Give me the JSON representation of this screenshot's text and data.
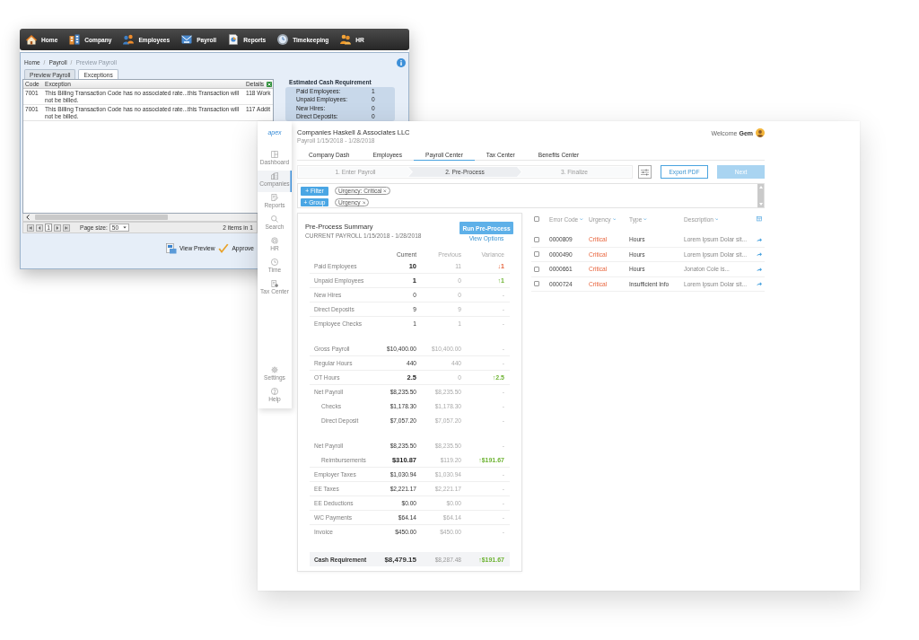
{
  "legacy_window": {
    "nav": [
      {
        "label": "Home"
      },
      {
        "label": "Company"
      },
      {
        "label": "Employees"
      },
      {
        "label": "Payroll"
      },
      {
        "label": "Reports"
      },
      {
        "label": "Timekeeping"
      },
      {
        "label": "HR"
      }
    ],
    "breadcrumb": [
      {
        "label": "Home",
        "current": false
      },
      {
        "label": "Payroll",
        "separator": "/",
        "current": false
      },
      {
        "label": "Preview Payroll",
        "separator": "/",
        "current": true
      }
    ],
    "tabs": [
      {
        "label": "Preview Payroll",
        "selected": false
      },
      {
        "label": "Exceptions",
        "selected": true
      }
    ],
    "table": {
      "columns": [
        "Code",
        "Exception",
        "Details"
      ],
      "rows": [
        [
          "7001",
          "This Billing Transaction Code has no associated rate...this Transaction will not be billed.",
          "118 Work"
        ],
        [
          "7001",
          "This Billing Transaction Code has no associated rate...this Transaction will not be billed.",
          "117 Addit"
        ]
      ]
    },
    "pager": {
      "page": "1",
      "page_size_label": "Page size:",
      "page_size": "50",
      "summary": "2 items in 1"
    },
    "actions": [
      "View Preview",
      "Approve"
    ],
    "cash_panel": {
      "title": "Estimated Cash Requirement",
      "rows": [
        {
          "label": "Paid Employees:",
          "value": "1"
        },
        {
          "label": "Unpaid Employees:",
          "value": "0"
        },
        {
          "label": "New Hires:",
          "value": "0"
        },
        {
          "label": "Direct Deposits:",
          "value": "0"
        }
      ]
    }
  },
  "app_window": {
    "sidebar": {
      "logo": "apex",
      "items": [
        {
          "label": "Dashboard",
          "selected": false
        },
        {
          "label": "Companies",
          "selected": true
        },
        {
          "label": "Reports",
          "selected": false
        },
        {
          "label": "Search",
          "selected": false
        },
        {
          "label": "HR",
          "selected": false
        },
        {
          "label": "Time",
          "selected": false
        },
        {
          "label": "Tax Center",
          "selected": false
        }
      ],
      "footer_items": [
        {
          "label": "Settings",
          "selected": false
        },
        {
          "label": "Help",
          "selected": false
        }
      ]
    },
    "header": {
      "title": "Companies Haskell & Associates LLC",
      "period": "Payroll 1/15/2018 - 1/28/2018",
      "greeting": "Welcome **Gem**"
    },
    "tabs": [
      {
        "label": "Company Dash",
        "selected": false
      },
      {
        "label": "Employees",
        "selected": false
      },
      {
        "label": "Payroll Center",
        "selected": true
      },
      {
        "label": "Tax Center",
        "selected": false
      },
      {
        "label": "Benefits Center",
        "selected": false
      }
    ],
    "steps": [
      {
        "label": "1. Enter Payroll",
        "selected": false
      },
      {
        "label": "2. Pre-Process",
        "selected": true
      },
      {
        "label": "3. Finalize",
        "selected": false
      }
    ],
    "actions": [
      {
        "label": "Export PDF",
        "kind": "outline",
        "disabled": false
      },
      {
        "label": "Next",
        "kind": "primary",
        "disabled": true
      }
    ],
    "filters": [
      {
        "button": "+ Filter",
        "chip": "Urgency: Critical"
      },
      {
        "button": "+ Group",
        "chip": "Urgency"
      }
    ],
    "summary": {
      "title": "Pre-Process Summary",
      "subtitle": "CURRENT PAYROLL 1/15/2018 - 1/28/2018",
      "run_button": "Run Pre-Process",
      "options_link": "View Options",
      "columns": [
        "Current",
        "Previous",
        "Variance"
      ],
      "groups": [
        [
          {
            "label": "Paid Employees",
            "current": "10",
            "previous": "11",
            "variance": "↓1",
            "kind": "down",
            "emphasized": true
          },
          {
            "label": "Unpaid Employees",
            "current": "1",
            "previous": "0",
            "variance": "↑1",
            "kind": "up",
            "emphasized": true
          },
          {
            "label": "New Hires",
            "current": "0",
            "previous": "0",
            "variance": "-",
            "kind": "flat",
            "emphasized": false
          },
          {
            "label": "Direct Deposits",
            "current": "9",
            "previous": "9",
            "variance": "-",
            "kind": "flat",
            "emphasized": false
          },
          {
            "label": "Employee Checks",
            "current": "1",
            "previous": "1",
            "variance": "-",
            "kind": "flat",
            "emphasized": false
          }
        ],
        [
          {
            "label": "Gross Payroll",
            "current": "$10,400.00",
            "previous": "$10,400.00",
            "variance": "-",
            "kind": "flat",
            "emphasized": false
          },
          {
            "label": "Regular Hours",
            "current": "440",
            "previous": "440",
            "variance": "-",
            "kind": "flat",
            "emphasized": false
          },
          {
            "label": "OT Hours",
            "current": "2.5",
            "previous": "0",
            "variance": "↑2.5",
            "kind": "up",
            "emphasized": true
          },
          {
            "label": "Net Payroll",
            "current": "$8,235.50",
            "previous": "$8,235.50",
            "variance": "-",
            "kind": "flat",
            "emphasized": false,
            "children": [
              {
                "label": "Checks",
                "current": "$1,178.30",
                "previous": "$1,178.30",
                "variance": "-",
                "kind": "flat",
                "emphasized": false
              },
              {
                "label": "Direct Deposit",
                "current": "$7,057.20",
                "previous": "$7,057.20",
                "variance": "-",
                "kind": "flat",
                "emphasized": false
              }
            ]
          }
        ],
        [
          {
            "label": "Net Payroll",
            "current": "$8,235.50",
            "previous": "$8,235.50",
            "variance": "-",
            "kind": "flat",
            "emphasized": false,
            "children": [
              {
                "label": "Reimbursements",
                "current": "$310.87",
                "previous": "$119.20",
                "variance": "↑$191.67",
                "kind": "up",
                "emphasized": true
              }
            ]
          },
          {
            "label": "Employer Taxes",
            "current": "$1,030.94",
            "previous": "$1,030.94",
            "variance": "-",
            "kind": "flat",
            "emphasized": false
          },
          {
            "label": "EE Taxes",
            "current": "$2,221.17",
            "previous": "$2,221.17",
            "variance": "-",
            "kind": "flat",
            "emphasized": false
          },
          {
            "label": "EE Deductions",
            "current": "$0.00",
            "previous": "$0.00",
            "variance": "-",
            "kind": "flat",
            "emphasized": false
          },
          {
            "label": "WC Payments",
            "current": "$64.14",
            "previous": "$64.14",
            "variance": "-",
            "kind": "flat",
            "emphasized": false
          },
          {
            "label": "Invoice",
            "current": "$450.00",
            "previous": "$450.00",
            "variance": "-",
            "kind": "flat",
            "emphasized": false
          }
        ]
      ],
      "total": {
        "label": "Cash Requirement",
        "current": "$8,479.15",
        "previous": "$8,287.48",
        "variance": "↑$191.67",
        "kind": "up"
      }
    },
    "errors": {
      "select_all_checked": false,
      "columns": [
        "Error Code",
        "Urgency",
        "Type",
        "Description"
      ],
      "rows": [
        {
          "checked": false,
          "code": "0000809",
          "urgency": "Critical",
          "type": "Hours",
          "description": "Lorem Ipsum Dolar sit..."
        },
        {
          "checked": false,
          "code": "0000490",
          "urgency": "Critical",
          "type": "Hours",
          "description": "Lorem Ipsum Dolar sit..."
        },
        {
          "checked": false,
          "code": "0000661",
          "urgency": "Critical",
          "type": "Hours",
          "description": "Jonaton Cole is..."
        },
        {
          "checked": false,
          "code": "0000724",
          "urgency": "Critical",
          "type": "Insufficient Info",
          "description": "Lorem Ipsum Dolar sit..."
        }
      ]
    }
  }
}
